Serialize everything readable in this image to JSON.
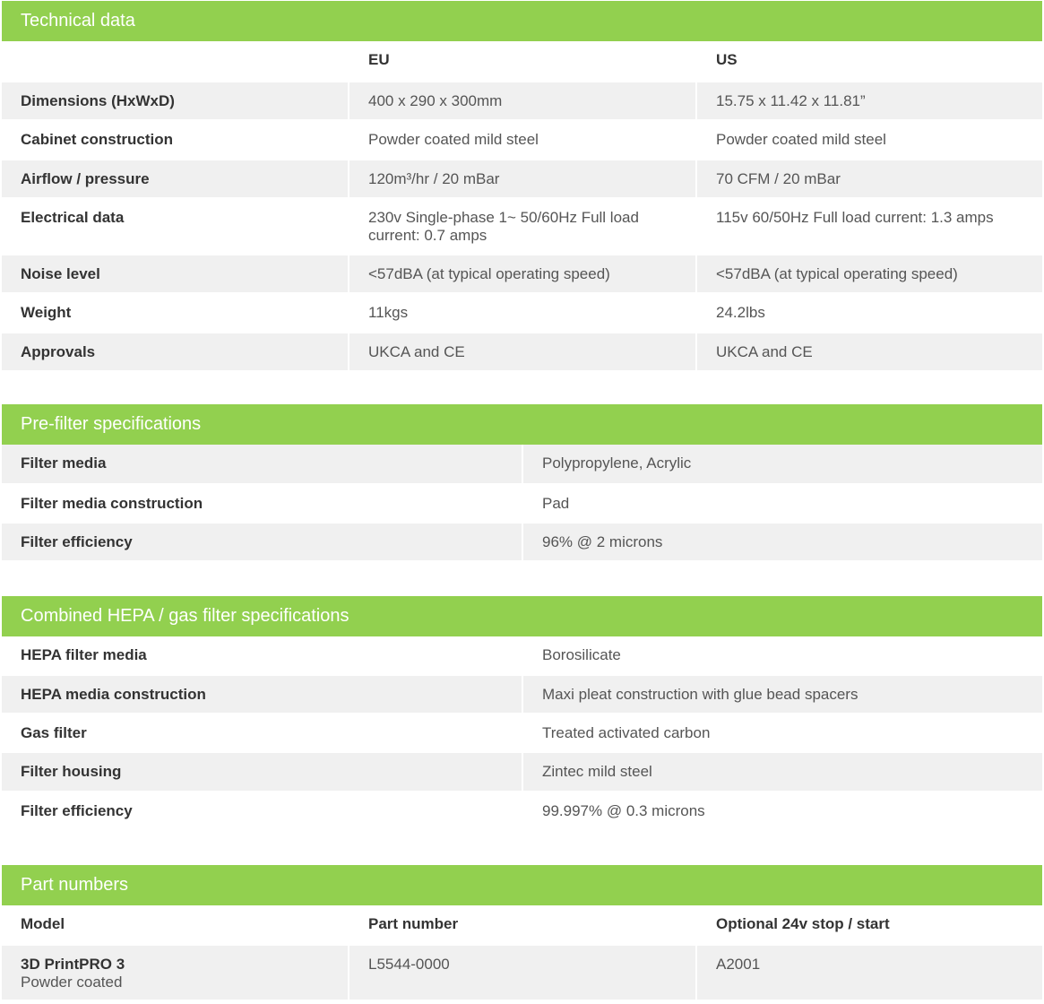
{
  "technical": {
    "title": "Technical data",
    "col_eu": "EU",
    "col_us": "US",
    "rows": [
      {
        "label": "Dimensions (HxWxD)",
        "eu": "400 x 290 x 300mm",
        "us": "15.75 x 11.42 x 11.81”"
      },
      {
        "label": "Cabinet construction",
        "eu": "Powder coated mild steel",
        "us": "Powder coated mild steel"
      },
      {
        "label": "Airflow / pressure",
        "eu": "120m³/hr / 20 mBar",
        "us": "70 CFM / 20 mBar"
      },
      {
        "label": "Electrical data",
        "eu": "230v Single-phase 1~ 50/60Hz Full load current: 0.7 amps",
        "us": "115v 60/50Hz Full load current: 1.3 amps"
      },
      {
        "label": "Noise level",
        "eu": "<57dBA (at typical operating speed)",
        "us": "<57dBA (at typical operating speed)"
      },
      {
        "label": "Weight",
        "eu": "11kgs",
        "us": "24.2lbs"
      },
      {
        "label": "Approvals",
        "eu": "UKCA and CE",
        "us": "UKCA and CE"
      }
    ]
  },
  "prefilter": {
    "title": "Pre-filter specifications",
    "rows": [
      {
        "label": "Filter media",
        "value": "Polypropylene, Acrylic"
      },
      {
        "label": "Filter media construction",
        "value": "Pad"
      },
      {
        "label": "Filter efficiency",
        "value": "96% @ 2 microns"
      }
    ]
  },
  "hepa": {
    "title": "Combined HEPA / gas filter specifications",
    "rows": [
      {
        "label": "HEPA filter media",
        "value": "Borosilicate"
      },
      {
        "label": "HEPA media construction",
        "value": "Maxi pleat construction with glue bead spacers"
      },
      {
        "label": "Gas filter",
        "value": "Treated activated carbon"
      },
      {
        "label": "Filter housing",
        "value": "Zintec mild steel"
      },
      {
        "label": "Filter efficiency",
        "value": "99.997% @ 0.3 microns"
      }
    ]
  },
  "parts": {
    "title": "Part numbers",
    "col_model": "Model",
    "col_part": "Part number",
    "col_optional": "Optional 24v stop / start",
    "rows": [
      {
        "model": "3D PrintPRO 3",
        "model_sub": "Powder coated",
        "part": "L5544-0000",
        "optional": "A2001"
      }
    ]
  }
}
